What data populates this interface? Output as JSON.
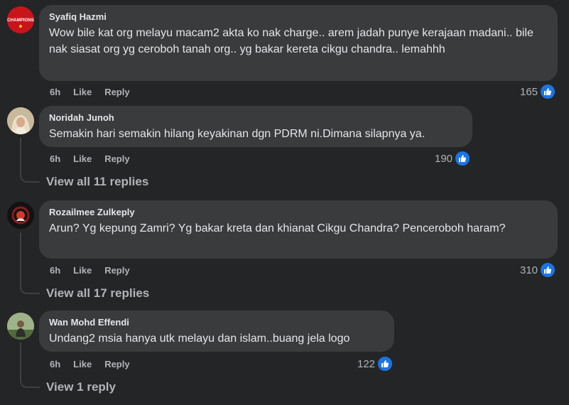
{
  "comments": [
    {
      "author": "Syafiq Hazmi",
      "avatar_icon": "champions-logo-icon",
      "avatar_text": "CHAMPIONS",
      "text": "Wow bile kat org melayu macam2 akta ko nak charge.. arem jadah punye kerajaan madani.. bile nak siasat org yg ceroboh tanah org.. yg bakar kereta cikgu chandra.. lemahhh",
      "time": "6h",
      "like_label": "Like",
      "reply_label": "Reply",
      "reaction_count": "165"
    },
    {
      "author": "Noridah Junoh",
      "avatar_icon": "profile-photo-icon",
      "text": "Semakin hari semakin hilang keyakinan dgn PDRM ni.Dimana silapnya ya.",
      "time": "6h",
      "like_label": "Like",
      "reply_label": "Reply",
      "reaction_count": "190",
      "view_replies": "View all 11 replies"
    },
    {
      "author": "Rozailmee Zulkeply",
      "avatar_icon": "profile-photo-icon",
      "text": "Arun? Yg kepung Zamri? Yg bakar kreta dan khianat Cikgu Chandra? Penceroboh haram?",
      "time": "6h",
      "like_label": "Like",
      "reply_label": "Reply",
      "reaction_count": "310",
      "view_replies": "View all 17 replies"
    },
    {
      "author": "Wan Mohd Effendi",
      "avatar_icon": "profile-photo-icon",
      "text": "Undang2 msia hanya utk melayu dan islam..buang jela logo",
      "time": "6h",
      "like_label": "Like",
      "reply_label": "Reply",
      "reaction_count": "122",
      "view_replies": "View 1 reply"
    }
  ],
  "colors": {
    "background": "#242526",
    "bubble": "#3a3b3c",
    "text": "#e4e6eb",
    "secondary_text": "#b0b3b8",
    "like_blue": "#1b74e4"
  }
}
